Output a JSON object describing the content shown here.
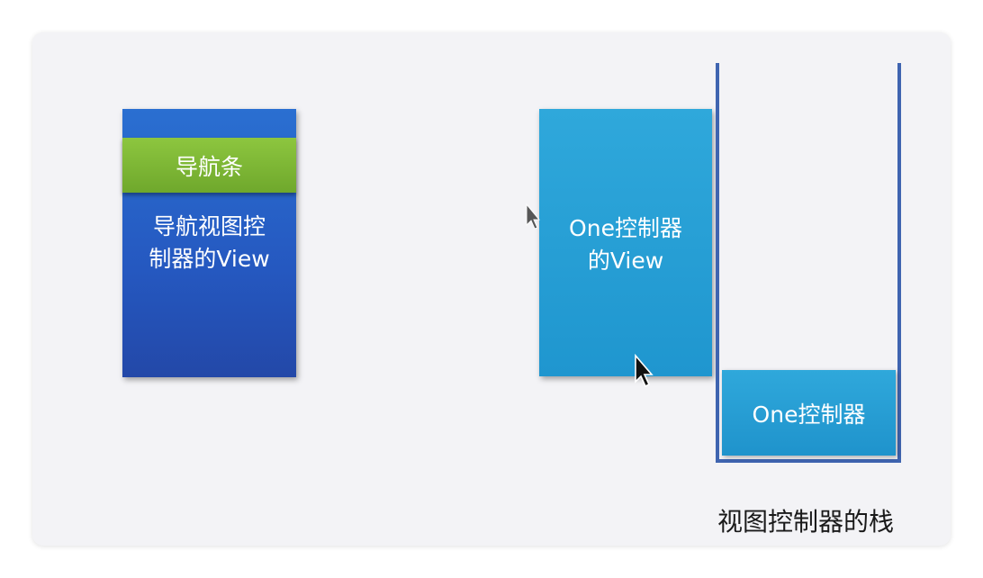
{
  "diagram": {
    "nav_bar_label": "导航条",
    "nav_view_label": "导航视图控\n制器的View",
    "one_view_label": "One控制器\n的View",
    "stack_item_label": "One控制器",
    "stack_caption": "视图控制器的栈"
  },
  "colors": {
    "nav_view": "#2558c0",
    "nav_bar": "#7ab535",
    "one_view": "#1f96cf",
    "stack_border": "#3f64b0",
    "slide_background": "#f3f3f6"
  },
  "icons": {
    "cursor": "mouse-pointer-icon"
  }
}
